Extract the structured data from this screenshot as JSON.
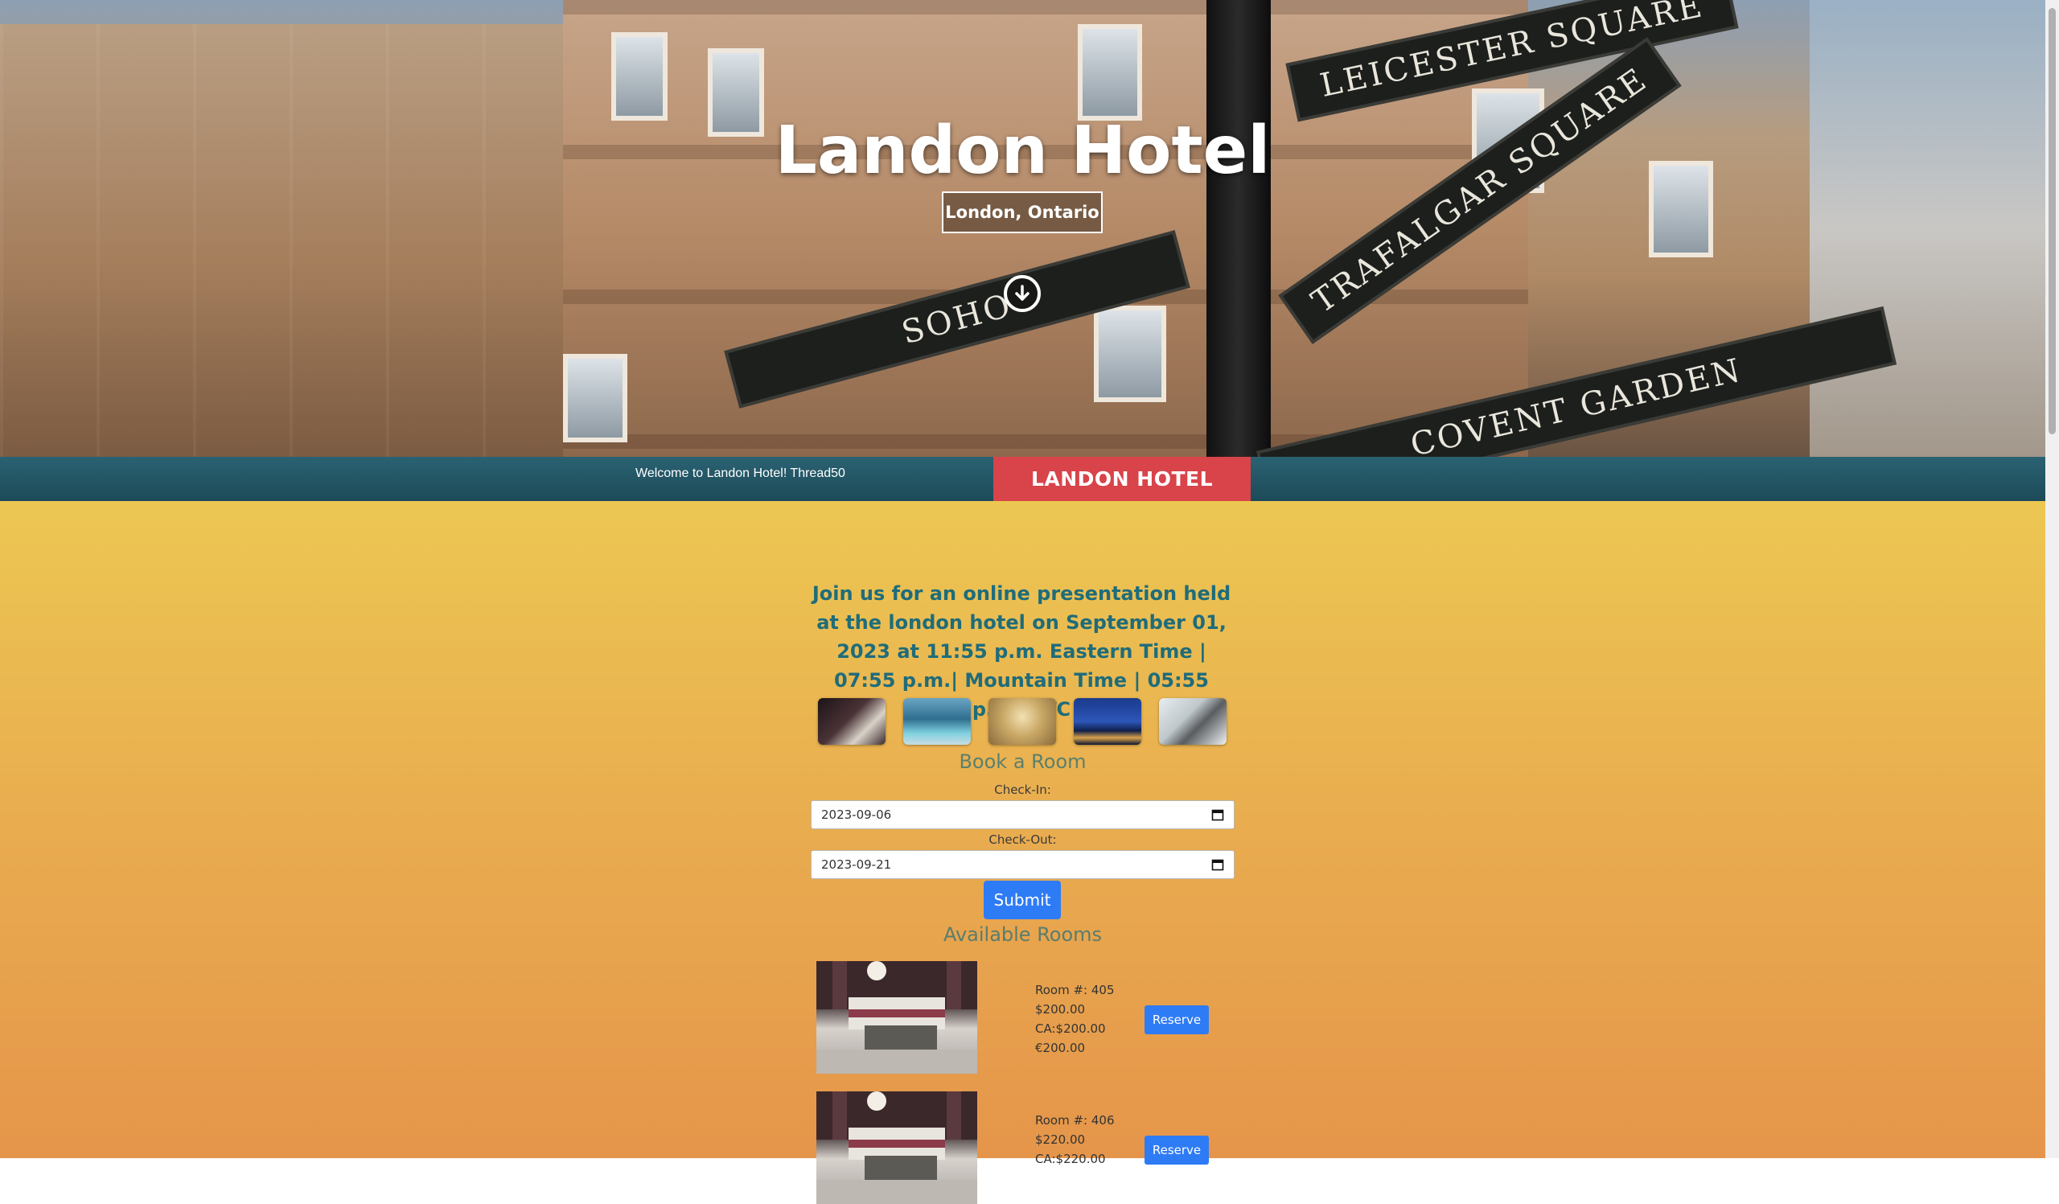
{
  "hero": {
    "title": "Landon Hotel",
    "subtitle": "London, Ontario",
    "street_signs": [
      "LEICESTER SQUARE",
      "TRAFALGAR SQUARE",
      "SOHO",
      "COVENT GARDEN"
    ]
  },
  "nav": {
    "welcome_text": "Welcome to Landon Hotel! Thread50",
    "brand": "LANDON HOTEL"
  },
  "announcement": "Join us for an online presentation held at the london hotel on September 01, 2023 at 11:55 p.m. Eastern Time | 07:55 p.m.| Mountain Time | 05:55 p.m. UTC",
  "gallery": [
    {
      "icon": "room-thumbnail"
    },
    {
      "icon": "pool-thumbnail"
    },
    {
      "icon": "lobby-thumbnail"
    },
    {
      "icon": "city-night-thumbnail"
    },
    {
      "icon": "wedding-thumbnail"
    }
  ],
  "booking": {
    "title": "Book a Room",
    "check_in_label": "Check-In:",
    "check_in_value": "2023-09-06",
    "check_out_label": "Check-Out:",
    "check_out_value": "2023-09-21",
    "submit_label": "Submit"
  },
  "available": {
    "title": "Available Rooms",
    "rooms": [
      {
        "room": "Room #: 405",
        "usd": "$200.00",
        "cad": "CA:$200.00",
        "eur": "€200.00",
        "reserve": "Reserve"
      },
      {
        "room": "Room #: 406",
        "usd": "$220.00",
        "cad": "CA:$220.00",
        "eur": "",
        "reserve": "Reserve"
      }
    ]
  },
  "colors": {
    "accent_teal": "#1f6c7a",
    "brand_red": "#d9434a",
    "button_blue": "#2e7bf6",
    "nav_bg": "#1d4a58"
  }
}
